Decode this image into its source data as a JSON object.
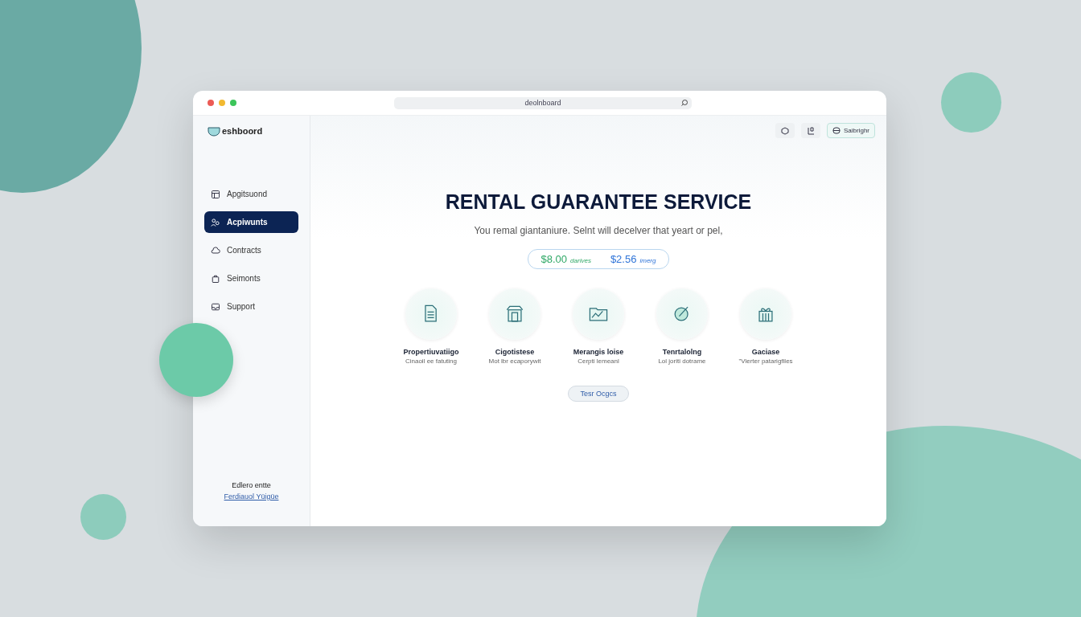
{
  "browser": {
    "url": "deolnboard"
  },
  "sidebar": {
    "logo": "eshboord",
    "items": [
      {
        "label": "Apgitsuond",
        "selected": false
      },
      {
        "label": "Acpiwunts",
        "selected": true
      },
      {
        "label": "Contracts",
        "selected": false
      },
      {
        "label": "Seimonts",
        "selected": false
      },
      {
        "label": "Support",
        "selected": false
      }
    ],
    "footer": {
      "text": "Edlero entte",
      "link": "Ferdiauol Yüigüe"
    }
  },
  "toolbar": {
    "button": "Saibrighr"
  },
  "hero": {
    "title": "RENTAL GUARANTEE SERVICE",
    "subtitle": "You remal giantaniure. Selnt will decelver that yeart or pel,",
    "prices": [
      {
        "amount": "$8.00",
        "label": "darives",
        "color": "#2fa866"
      },
      {
        "amount": "$2.56",
        "label": "imerg",
        "color": "#2f74d8"
      }
    ]
  },
  "features": [
    {
      "title": "Propertiuvatiigo",
      "subtitle": "Cinaoil ee fatuting"
    },
    {
      "title": "Cigotistese",
      "subtitle": "Mot lbr ecaporywit"
    },
    {
      "title": "Merangis loise",
      "subtitle": "Cerpti lemeanl"
    },
    {
      "title": "Tenrtalolng",
      "subtitle": "Lol joriti dotrame"
    },
    {
      "title": "Gaciase",
      "subtitle": "\"Vierter patarigfiles"
    }
  ],
  "cta": {
    "label": "Tesr Ocgcs"
  }
}
